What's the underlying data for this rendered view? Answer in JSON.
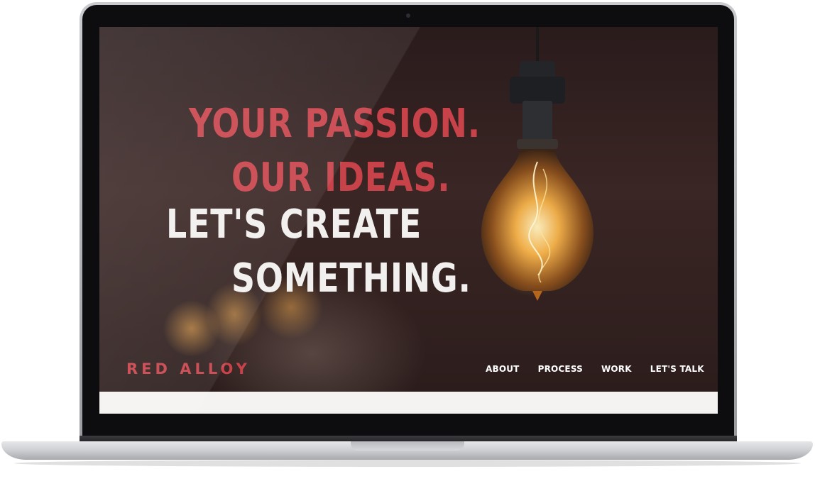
{
  "hero": {
    "line1": "YOUR PASSION.",
    "line2": "OUR IDEAS.",
    "line3": "LET'S CREATE",
    "line4": "SOMETHING."
  },
  "brand": "RED ALLOY",
  "nav": [
    "ABOUT",
    "PROCESS",
    "WORK",
    "LET'S TALK"
  ],
  "colors": {
    "accent": "#c8424a",
    "headline_light": "#f2f0ee",
    "background": "#2b1c1c"
  },
  "icons": [
    "light-bulb-image",
    "laptop-frame"
  ]
}
